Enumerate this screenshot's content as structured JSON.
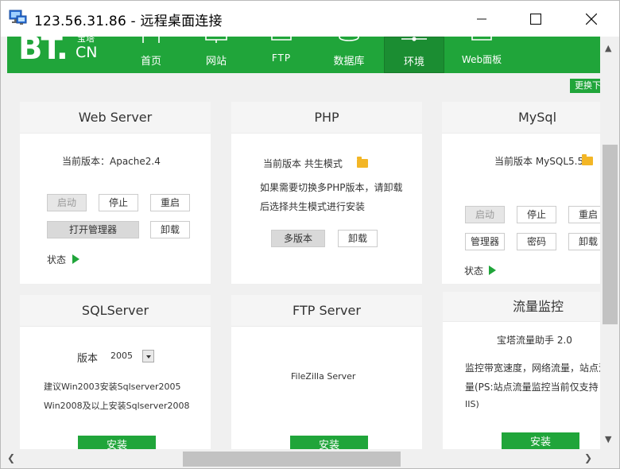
{
  "window": {
    "title": "123.56.31.86 - 远程桌面连接"
  },
  "brand": {
    "logo": "BT.",
    "cn": "CN",
    "top": "宝塔"
  },
  "nav": {
    "items": [
      {
        "label": "首页",
        "icon": "home-icon"
      },
      {
        "label": "网站",
        "icon": "monitor-icon"
      },
      {
        "label": "FTP",
        "icon": "folder-icon"
      },
      {
        "label": "数据库",
        "icon": "database-icon"
      },
      {
        "label": "环境",
        "icon": "slider-icon"
      },
      {
        "label": "Web面板",
        "icon": "panel-icon"
      }
    ],
    "active": "环境"
  },
  "change_btn": "更换下",
  "cards": {
    "web": {
      "title": "Web Server",
      "version": "当前版本：Apache2.4",
      "start": "启动",
      "stop": "停止",
      "restart": "重启",
      "manager": "打开管理器",
      "uninstall": "卸载",
      "status": "状态"
    },
    "php": {
      "title": "PHP",
      "version": "当前版本 共生模式",
      "desc1": "如果需要切换多PHP版本，请卸载",
      "desc2": "后选择共生模式进行安装",
      "multi": "多版本",
      "uninstall": "卸载"
    },
    "mysql": {
      "title": "MySql",
      "version": "当前版本 MySQL5.5",
      "start": "启动",
      "stop": "停止",
      "restart": "重启",
      "manager": "管理器",
      "password": "密码",
      "uninstall": "卸载",
      "status": "状态"
    },
    "sqlserver": {
      "title": "SQLServer",
      "version_label": "版本",
      "version_value": "2005",
      "desc1": "建议Win2003安装Sqlserver2005",
      "desc2": "Win2008及以上安装Sqlserver2008",
      "install": "安装"
    },
    "ftp": {
      "title": "FTP Server",
      "name": "FileZilla Server",
      "install": "安装"
    },
    "traffic": {
      "title": "流量监控",
      "subtitle": "宝塔流量助手 2.0",
      "desc1": "监控带宽速度，网络流量，站点流",
      "desc2": "量(PS:站点流量监控当前仅支持",
      "desc3": "IIS)",
      "install": "安装"
    }
  },
  "colors": {
    "accent": "#20a53a",
    "folder": "#f3b626"
  }
}
